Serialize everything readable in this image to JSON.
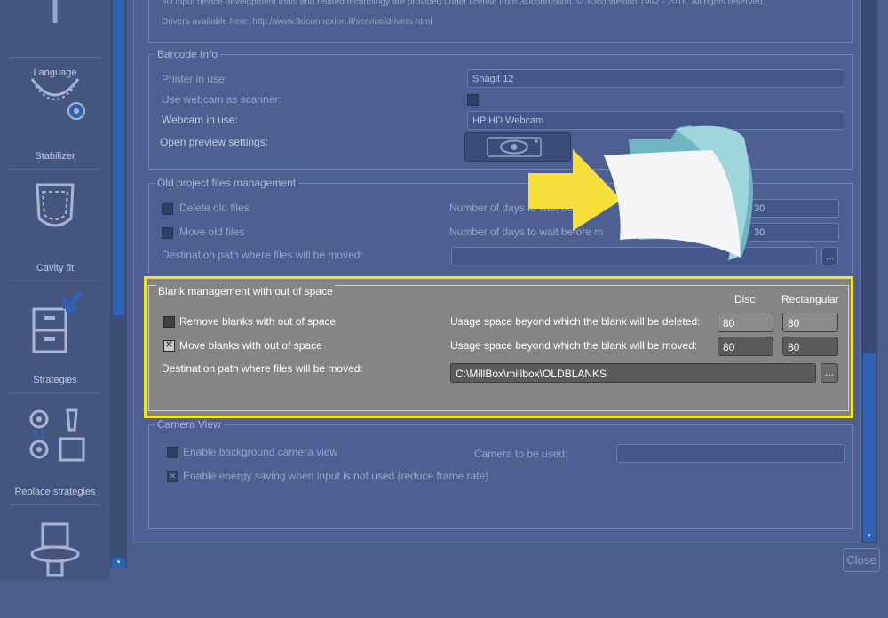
{
  "sidebar": {
    "items": [
      {
        "label": "Language",
        "icon": "language-icon"
      },
      {
        "label": "Stabilizer",
        "icon": "stabilizer-icon"
      },
      {
        "label": "Cavity fit",
        "icon": "cavity-fit-icon"
      },
      {
        "label": "Strategies",
        "icon": "strategies-icon"
      },
      {
        "label": "Replace strategies",
        "icon": "replace-strategies-icon"
      },
      {
        "label": "",
        "icon": "tool-icon"
      }
    ]
  },
  "top": {
    "line1": "3D input device development tools and related technology are provided under license from 3Dconnexion. © 3Dconnexion 1992 - 2016. All rights reserved.",
    "line2": "Drivers available here: http://www.3dconnexion.it/service/drivers.html"
  },
  "barcode": {
    "title": "Barcode Info",
    "printer_label": "Printer in use:",
    "printer_value": "Snagit 12",
    "webcam_scanner_label": "Use webcam as scanner:",
    "webcam_label": "Webcam in use:",
    "webcam_value": "HP HD Webcam",
    "preview_label": "Open preview settings:"
  },
  "old_project": {
    "title": "Old project files management",
    "delete_label": "Delete old files",
    "move_label": "Move old files",
    "days_delete_label": "Number of days to wait be",
    "days_move_label": "Number of days to wait before m",
    "days_delete_value": "30",
    "days_move_value": "30",
    "dest_label": "Destination path where files will be moved:",
    "dest_btn": "..."
  },
  "blank": {
    "title": "Blank management with out of space",
    "col_disc": "Disc",
    "col_rect": "Rectangular",
    "remove_label": "Remove blanks with out of space",
    "move_label": "Move blanks with out of space",
    "move_check": "✕",
    "usage_delete_label": "Usage space beyond which the blank will be deleted:",
    "usage_move_label": "Usage space beyond which the blank will be moved:",
    "delete_disc": "80",
    "delete_rect": "80",
    "move_disc": "80",
    "move_rect": "80",
    "dest_label": "Destination path where files will be moved:",
    "dest_value": "C:\\MillBox\\millbox\\OLDBLANKS",
    "dest_btn": "..."
  },
  "camera": {
    "title": "Camera View",
    "bg_label": "Enable background camera view",
    "camera_label": "Camera to be used:",
    "energy_label": "Enable energy saving when input is not used (reduce frame rate)",
    "energy_check": "✕"
  },
  "close_label": "Close",
  "colors": {
    "highlight_border": "#f3e61f",
    "arrow": "#f8de3a",
    "folder": "#7fc4cc"
  }
}
